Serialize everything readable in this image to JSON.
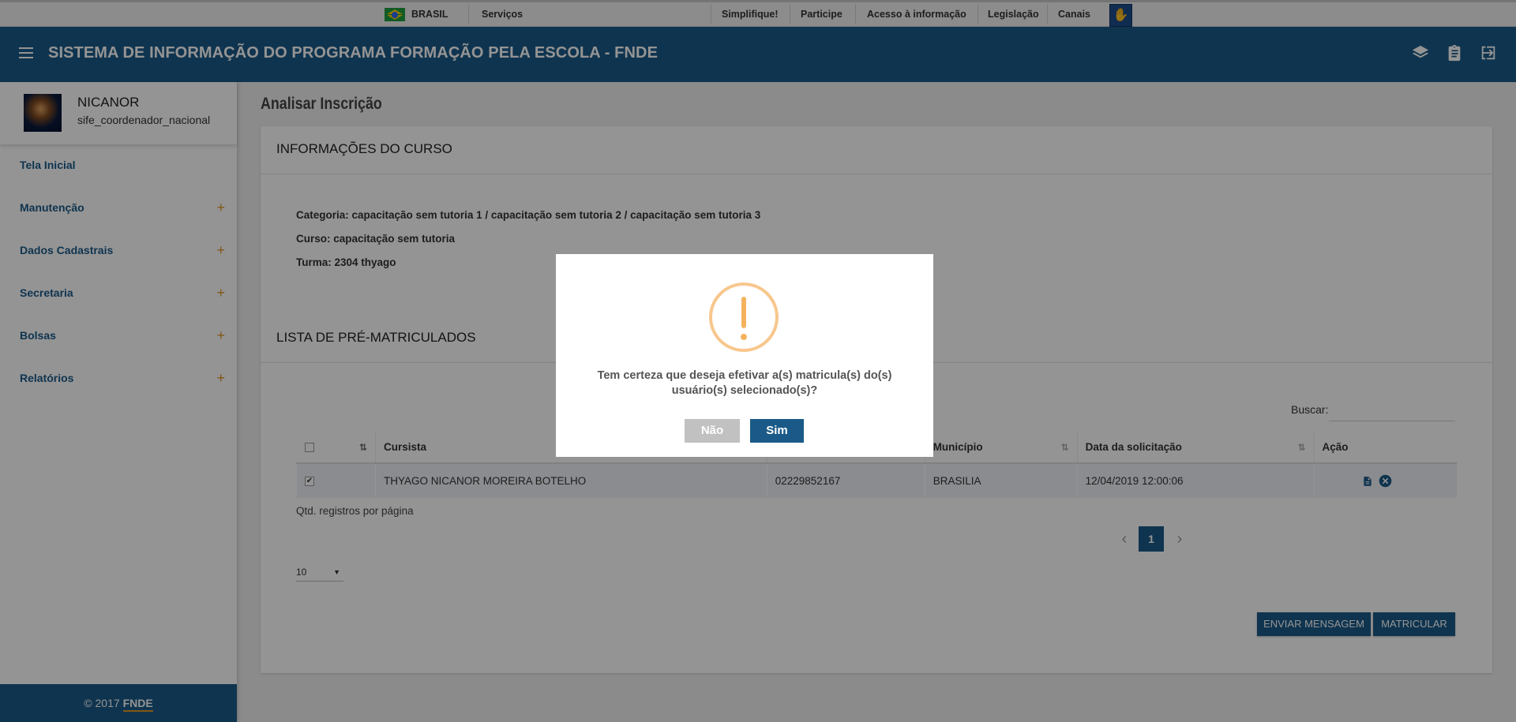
{
  "govbar": {
    "country": "BRASIL",
    "services": "Serviços",
    "links": [
      "Simplifique!",
      "Participe",
      "Acesso à informação",
      "Legislação",
      "Canais"
    ]
  },
  "app": {
    "title": "SISTEMA DE INFORMAÇÃO DO PROGRAMA FORMAÇÃO PELA ESCOLA - FNDE"
  },
  "user": {
    "name": "NICANOR",
    "role": "sife_coordenador_nacional"
  },
  "sidebar": {
    "items": [
      {
        "label": "Tela Inicial",
        "expandable": false
      },
      {
        "label": "Manutenção",
        "expandable": true
      },
      {
        "label": "Dados Cadastrais",
        "expandable": true
      },
      {
        "label": "Secretaria",
        "expandable": true
      },
      {
        "label": "Bolsas",
        "expandable": true
      },
      {
        "label": "Relatórios",
        "expandable": true
      }
    ],
    "plus": "+",
    "footer_prefix": "© 2017",
    "footer_brand": "FNDE"
  },
  "page": {
    "title": "Analisar Inscrição",
    "course_section": "INFORMAÇÕES DO CURSO",
    "categoria": "Categoria: capacitação sem tutoria 1 / capacitação sem tutoria 2 / capacitação sem tutoria 3",
    "curso": "Curso: capacitação sem tutoria",
    "turma": "Turma: 2304 thyago",
    "list_section": "LISTA DE PRÉ-MATRICULADOS",
    "search_label": "Buscar:",
    "search_value": ""
  },
  "table": {
    "headers": [
      "Cursista",
      "",
      "Município",
      "Data da solicitação",
      "Ação"
    ],
    "rows": [
      {
        "checked": true,
        "cursista": "THYAGO NICANOR MOREIRA BOTELHO",
        "cpf": "02229852167",
        "municipio": "BRASILIA",
        "data": "12/04/2019 12:00:06"
      }
    ]
  },
  "pagination": {
    "per_page_label": "Qtd. registros por página",
    "per_page_value": "10",
    "current_page": "1",
    "prev": "‹",
    "next": "›"
  },
  "actions": {
    "send_message": "ENVIAR MENSAGEM",
    "enroll": "MATRICULAR"
  },
  "modal": {
    "message": "Tem certeza que deseja efetivar a(s) matricula(s) do(s) usuário(s) selecionado(s)?",
    "no_label": "Não",
    "yes_label": "Sim"
  },
  "colors": {
    "primary": "#1b5a88",
    "accent": "#e09a2a",
    "warning": "#f8c78d",
    "no_button": "#c1c1c1"
  },
  "icons": {
    "check_glyph": "✔",
    "vlibras_glyph": "✋",
    "select_caret": "▼",
    "sort_glyph": "⇅",
    "exclamation": "!"
  }
}
